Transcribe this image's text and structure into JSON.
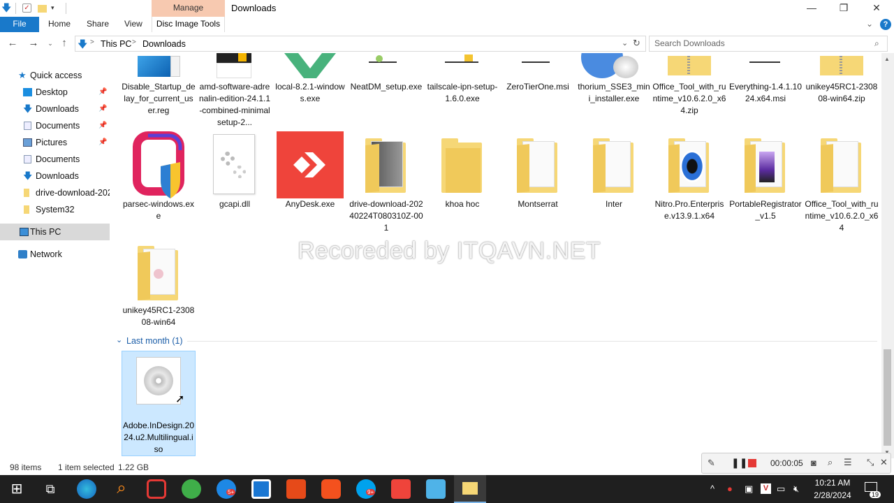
{
  "window": {
    "title": "Downloads",
    "manage_tab": "Manage",
    "minimize": "—",
    "restore": "❐",
    "close": "✕"
  },
  "ribbon": {
    "file": "File",
    "home": "Home",
    "share": "Share",
    "view": "View",
    "disc_image_tools": "Disc Image Tools",
    "help": "?"
  },
  "address": {
    "crumbs": [
      "This PC",
      "Downloads"
    ],
    "separator": ">",
    "search_placeholder": "Search Downloads"
  },
  "sidebar": {
    "items": [
      {
        "label": "Quick access",
        "icon": "star-icon",
        "pinned": false
      },
      {
        "label": "Desktop",
        "icon": "desktop-icon",
        "pinned": true
      },
      {
        "label": "Downloads",
        "icon": "download-arrow-icon",
        "pinned": true
      },
      {
        "label": "Documents",
        "icon": "documents-icon",
        "pinned": true
      },
      {
        "label": "Pictures",
        "icon": "pictures-icon",
        "pinned": true
      },
      {
        "label": "Documents",
        "icon": "documents-icon",
        "pinned": false
      },
      {
        "label": "Downloads",
        "icon": "download-arrow-icon",
        "pinned": false
      },
      {
        "label": "drive-download-202",
        "icon": "folder-icon",
        "pinned": false
      },
      {
        "label": "System32",
        "icon": "folder-icon",
        "pinned": false
      },
      {
        "label": "This PC",
        "icon": "computer-icon",
        "pinned": false
      },
      {
        "label": "Network",
        "icon": "network-icon",
        "pinned": false
      }
    ]
  },
  "files_row1": [
    "Disable_Startup_delay_for_current_user.reg",
    "amd-software-adrenalin-edition-24.1.1-combined-minimalsetup-2...",
    "local-8.2.1-windows.exe",
    "NeatDM_setup.exe",
    "tailscale-ipn-setup-1.6.0.exe",
    "ZeroTierOne.msi",
    "thorium_SSE3_mini_installer.exe",
    "Office_Tool_with_runtime_v10.6.2.0_x64.zip",
    "Everything-1.4.1.1024.x64.msi",
    "unikey45RC1-230808-win64.zip"
  ],
  "files_row2": [
    "parsec-windows.exe",
    "gcapi.dll",
    "AnyDesk.exe",
    "drive-download-20240224T080310Z-001",
    "khoa hoc",
    "Montserrat",
    "Inter",
    "Nitro.Pro.Enterprise.v13.9.1.x64",
    "PortableRegistrator_v1.5",
    "Office_Tool_with_runtime_v10.6.2.0_x64"
  ],
  "files_row3": [
    "unikey45RC1-230808-win64"
  ],
  "group": {
    "label": "Last month (1)"
  },
  "selected_file": "Adobe.InDesign.2024.u2.Multilingual.iso",
  "status": {
    "items": "98 items",
    "selected": "1 item selected",
    "size": "1.22 GB"
  },
  "watermark": "Recoreded by ITQAVN.NET",
  "recorder": {
    "time": "00:00:05"
  },
  "taskbar": {
    "time": "10:21 AM",
    "date": "2/28/2024",
    "notifications": "19",
    "badge1": "5+",
    "badge2": "9+"
  },
  "colors": {
    "accent": "#1979ca",
    "selection": "#cce8ff",
    "anydesk": "#ef443b",
    "folder": "#f6d776"
  }
}
